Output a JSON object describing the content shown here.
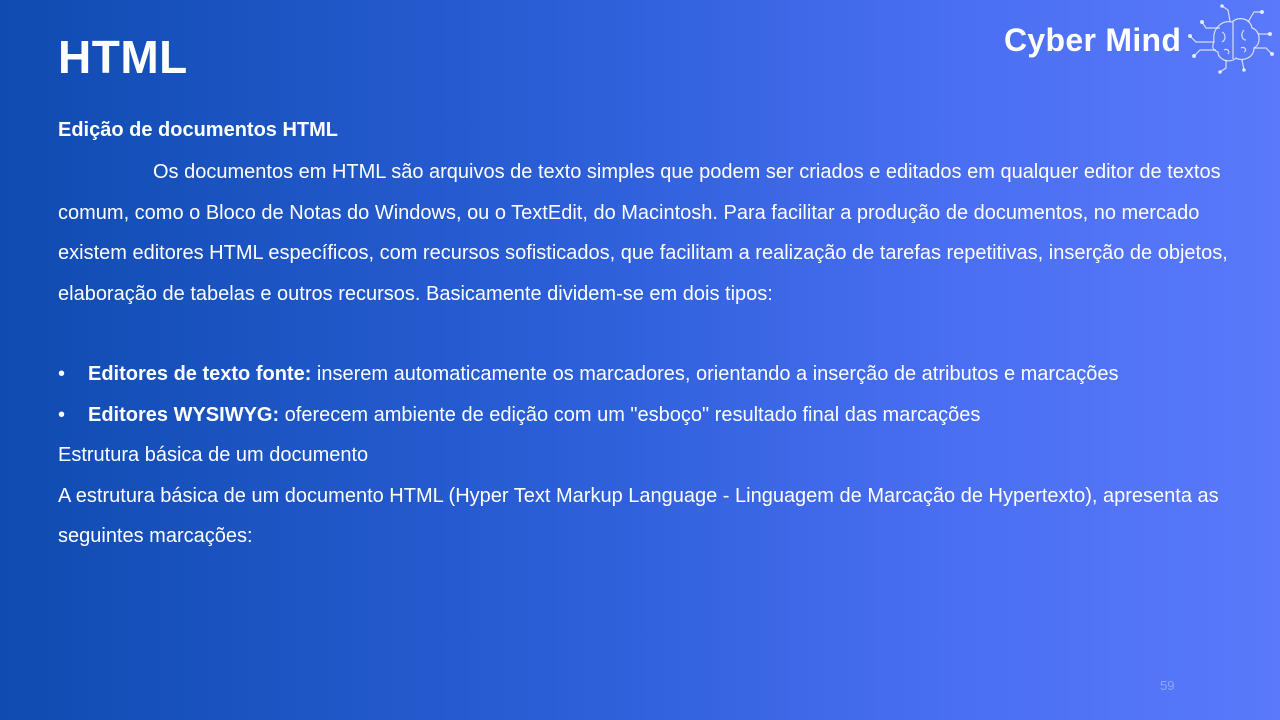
{
  "slide": {
    "title": "HTML",
    "logo": {
      "text": "Cyber Mind",
      "icon": "brain-circuit-icon"
    },
    "subtitle": "Edição de documentos HTML",
    "paragraph": "Os documentos em HTML são arquivos de texto simples que podem ser criados e editados em qualquer editor de textos comum, como o Bloco de Notas do Windows, ou o TextEdit, do Macintosh. Para facilitar a produção de documentos, no mercado existem editores HTML específicos, com recursos sofisticados, que facilitam a realização de tarefas repetitivas, inserção de objetos, elaboração de tabelas e outros recursos. Basicamente dividem-se em dois tipos:",
    "bullets": [
      {
        "marker": "•",
        "term": "Editores de texto fonte:",
        "text": " inserem automaticamente os marcadores, orientando a inserção de atributos e marcações"
      },
      {
        "marker": "•",
        "term": "Editores WYSIWYG:",
        "text": " oferecem ambiente de edição com um \"esboço\" resultado final das marcações"
      }
    ],
    "structure_heading": "Estrutura básica de um documento",
    "structure_text": "A estrutura básica de um documento HTML (Hyper Text Markup Language - Linguagem de Marcação de Hypertexto), apresenta as seguintes marcações:",
    "page_number": "59"
  }
}
